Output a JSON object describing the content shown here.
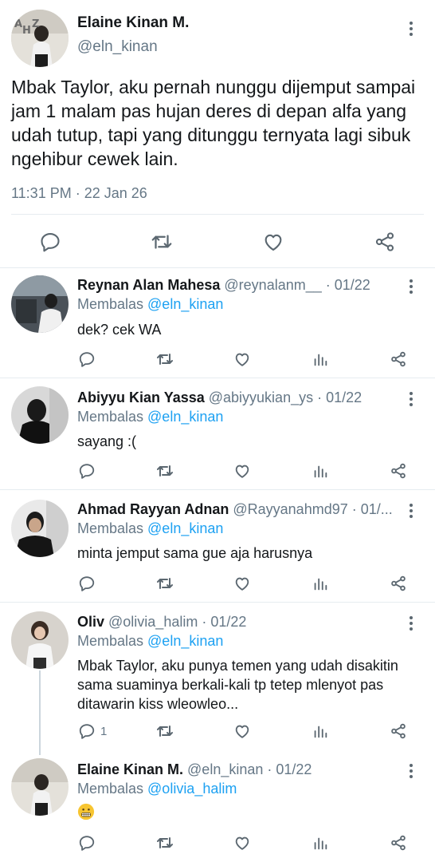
{
  "main_tweet": {
    "author_name": "Elaine Kinan M.",
    "author_handle": "@eln_kinan",
    "avatar_overlay_text": "AHZ",
    "text": "Mbak Taylor, aku pernah nunggu dijemput sampai jam 1 malam pas hujan deres di depan alfa yang udah tutup, tapi yang ditunggu ternyata lagi sibuk ngehibur cewek lain.",
    "timestamp": "11:31 PM · 22 Jan 26",
    "actions": [
      "reply-icon",
      "retweet-icon",
      "like-icon",
      "share-icon"
    ]
  },
  "replies": [
    {
      "name": "Reynan Alan Mahesa",
      "meta": " @reynalanm__ · 01/22",
      "replying_prefix": "Membalas ",
      "replying_to": "@eln_kinan",
      "text": "dek? cek WA",
      "reply_count": ""
    },
    {
      "name": "Abiyyu Kian Yassa",
      "meta": " @abiyyukian_ys · 01/22",
      "replying_prefix": "Membalas ",
      "replying_to": "@eln_kinan",
      "text": "sayang :(",
      "reply_count": ""
    },
    {
      "name": "Ahmad Rayyan Adnan",
      "meta": " @Rayyanahmd97 · 01/...",
      "replying_prefix": "Membalas ",
      "replying_to": "@eln_kinan",
      "text": "minta jemput sama gue aja harusnya",
      "reply_count": ""
    },
    {
      "name": "Oliv",
      "meta": " @olivia_halim · 01/22",
      "replying_prefix": "Membalas ",
      "replying_to": "@eln_kinan",
      "text": "Mbak Taylor, aku punya temen yang udah disakitin sama suaminya berkali-kali tp tetep mlenyot pas ditawarin kiss wleowleo...",
      "reply_count": "1"
    },
    {
      "name": "Elaine Kinan M.",
      "meta": " @eln_kinan · 01/22",
      "replying_prefix": "Membalas ",
      "replying_to": "@olivia_halim",
      "text": "",
      "emoji": "grimacing-face",
      "reply_count": ""
    }
  ],
  "colors": {
    "text": "#14171a",
    "secondary": "#657786",
    "mention": "#1da1f2",
    "divider": "#e6ecf0",
    "icon": "#5b6770"
  }
}
